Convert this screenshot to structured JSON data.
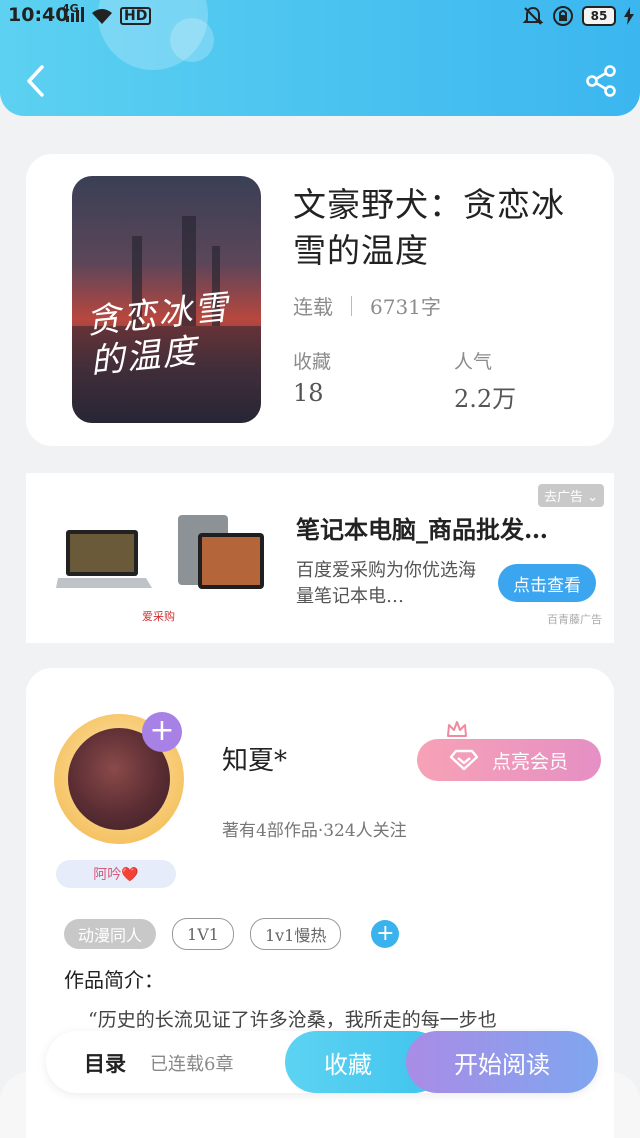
{
  "status_bar": {
    "time": "10:40",
    "network": "4G",
    "hd": "HD",
    "battery": "85"
  },
  "book": {
    "cover_text": "贪恋冰雪的温度",
    "title": "文豪野犬：贪恋冰雪的温度",
    "status": "连载",
    "word_count": "6731字",
    "stats": {
      "favorites_label": "收藏",
      "favorites_value": "18",
      "popularity_label": "人气",
      "popularity_value": "2.2万"
    }
  },
  "ad": {
    "tag": "去广告 ⌄",
    "title": "笔记本电脑_商品批发…",
    "description": "百度爱采购为你优选海量笔记本电…",
    "button": "点击查看",
    "source": "百青藤广告",
    "brand": "爱采购"
  },
  "author": {
    "name": "知夏*",
    "subtitle": "著有4部作品·324人关注",
    "badge": "阿吟❤️",
    "vip_button": "点亮会员",
    "plus": "+"
  },
  "tags": [
    "动漫同人",
    "1V1",
    "1v1慢热"
  ],
  "tag_add": "+",
  "intro": {
    "title": "作品简介：",
    "text": "“历史的长流见证了许多沧桑，我所走的每一步也"
  },
  "bottom_bar": {
    "toc": "目录",
    "toc_status": "已连载6章",
    "favorite": "收藏",
    "read": "开始阅读"
  }
}
